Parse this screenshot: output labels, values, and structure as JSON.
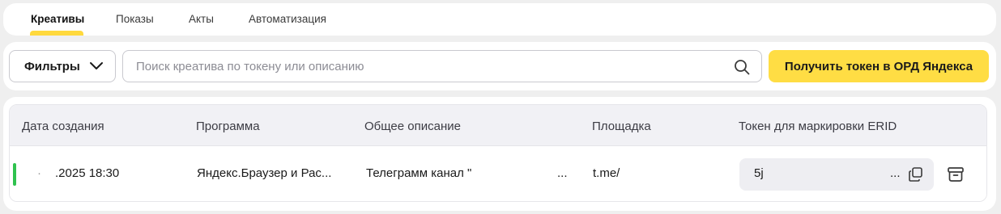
{
  "tabs": [
    {
      "label": "Креативы",
      "active": true
    },
    {
      "label": "Показы",
      "active": false
    },
    {
      "label": "Акты",
      "active": false
    },
    {
      "label": "Автоматизация",
      "active": false
    }
  ],
  "toolbar": {
    "filter_label": "Фильтры",
    "filter_icon": "chevron-down-icon",
    "search_placeholder": "Поиск креатива по токену или описанию",
    "search_value": "",
    "search_icon": "search-icon",
    "token_button_label": "Получить токен в ОРД Яндекса"
  },
  "table": {
    "columns": [
      "Дата создания",
      "Программа",
      "Общее описание",
      "Площадка",
      "Токен для маркировки ERID"
    ],
    "rows": [
      {
        "status": "active",
        "date_prefix": "·",
        "date": ".2025 18:30",
        "program": "Яндекс.Браузер и Рас...",
        "description": "Телеграмм канал \"",
        "description_ellipsis": "...",
        "platform": "t.me/",
        "token": "5j",
        "token_ellipsis": "...",
        "copy_icon": "copy-icon",
        "archive_icon": "archive-icon"
      }
    ]
  },
  "colors": {
    "accent_yellow": "#ffdd44",
    "status_green": "#2fc24e",
    "page_bg": "#efefef"
  }
}
